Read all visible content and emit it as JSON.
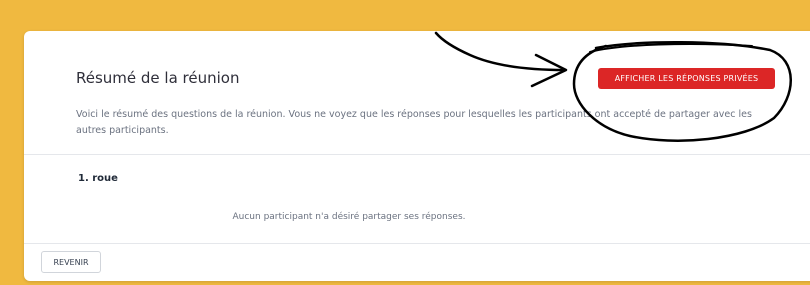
{
  "summary": {
    "title": "Résumé de la réunion",
    "description": "Voici le résumé des questions de la réunion. Vous ne voyez que les réponses pour lesquelles les participants ont accepté de partager avec les autres participants.",
    "show_private_label": "AFFICHER LES RÉPONSES PRIVÉES"
  },
  "questions": [
    {
      "label": "1. roue",
      "empty_message": "Aucun participant n'a désiré partager ses réponses."
    }
  ],
  "footer": {
    "back_label": "REVENIR"
  },
  "colors": {
    "background": "#f0b940",
    "primary_button": "#dc2626",
    "annotation": "#000000"
  }
}
